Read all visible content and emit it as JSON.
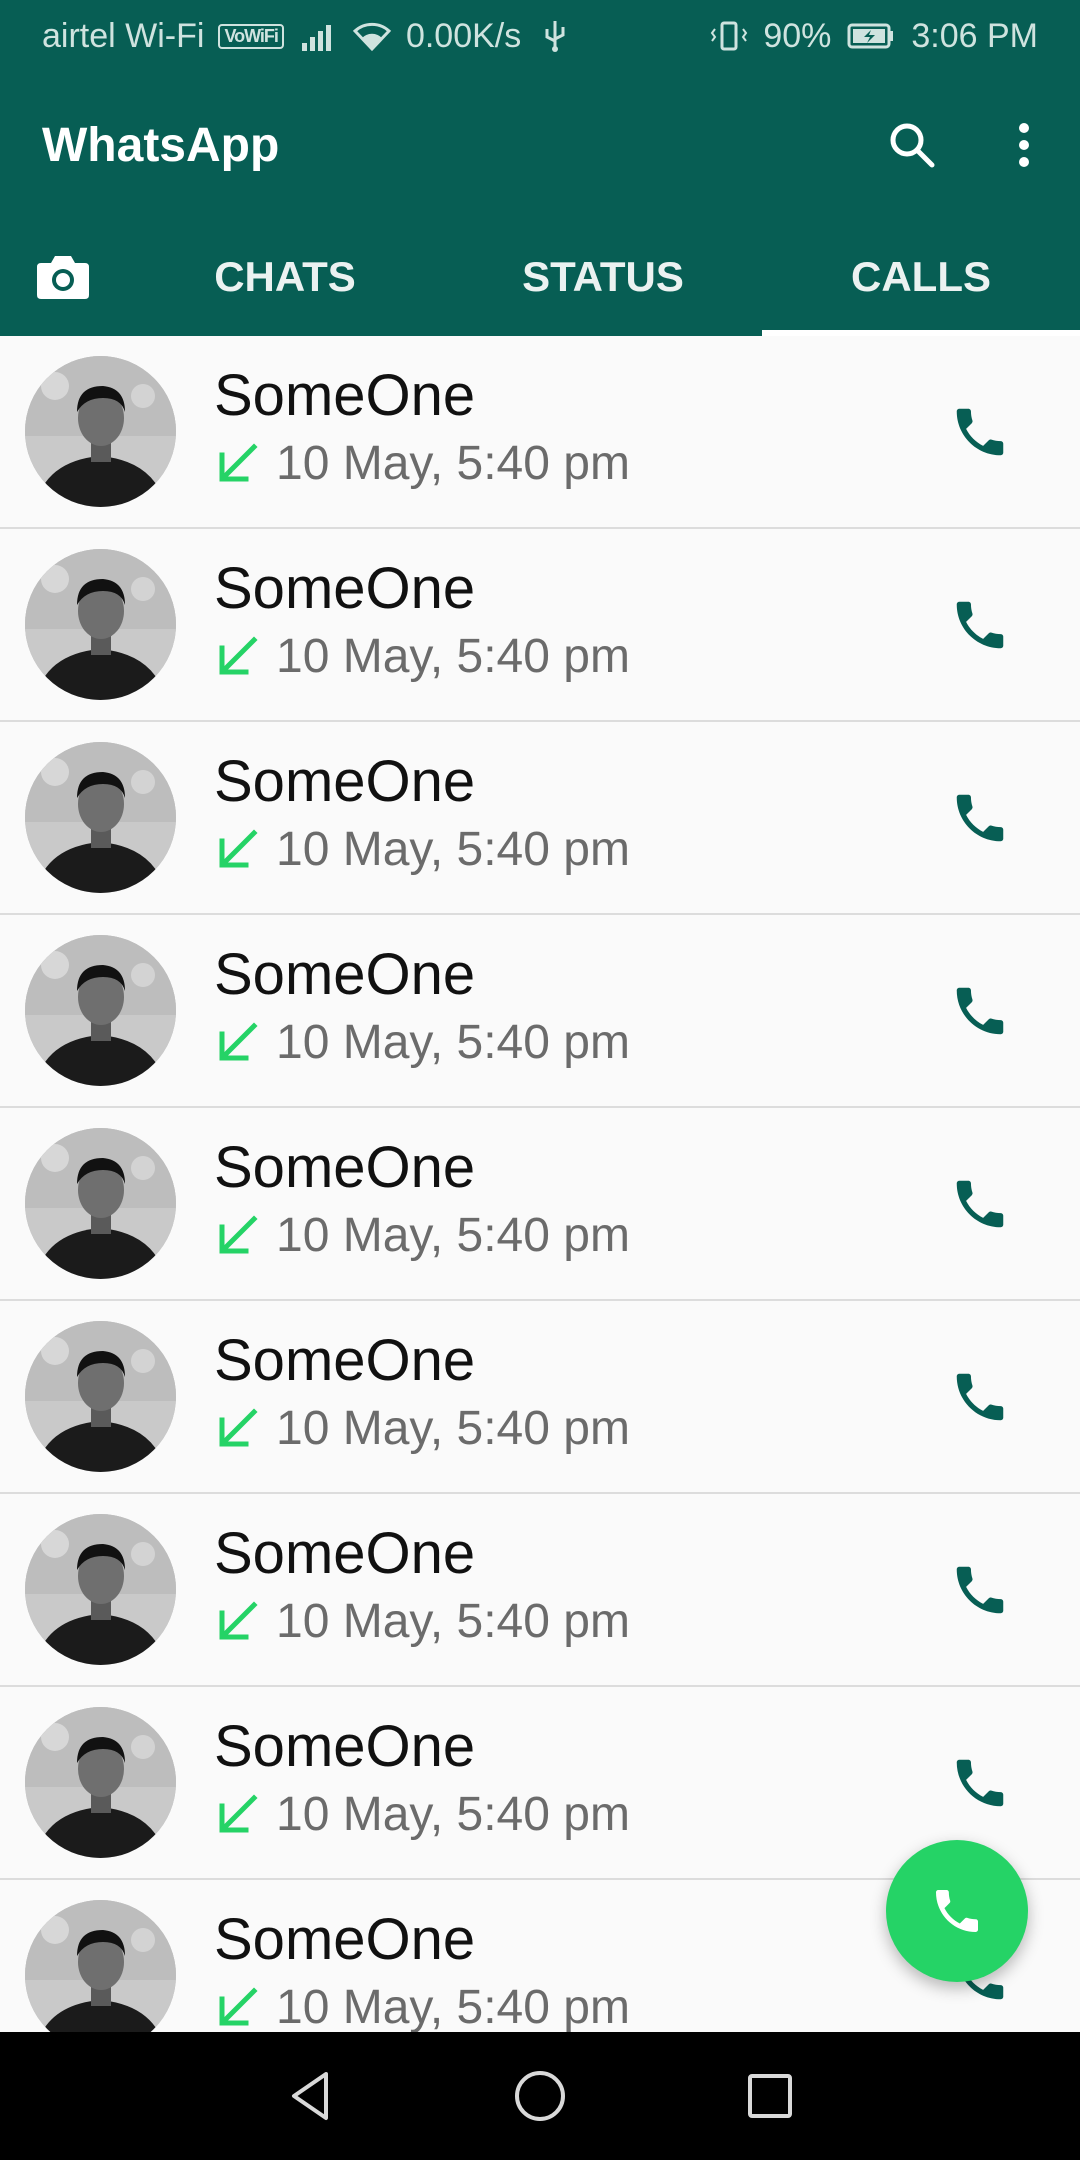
{
  "status_bar": {
    "carrier": "airtel Wi-Fi",
    "volte_badge": "VoWiFi",
    "net_speed": "0.00K/s",
    "battery": "90%",
    "time": "3:06 PM"
  },
  "header": {
    "title": "WhatsApp",
    "search_icon": "search-icon",
    "menu_icon": "more-vert-icon"
  },
  "tabs": [
    {
      "label": "",
      "icon": "camera-icon",
      "active": false
    },
    {
      "label": "CHATS",
      "active": false
    },
    {
      "label": "STATUS",
      "active": false
    },
    {
      "label": "CALLS",
      "active": true
    }
  ],
  "calls": [
    {
      "name": "SomeOne",
      "time": "10 May, 5:40 pm",
      "direction": "incoming"
    },
    {
      "name": "SomeOne",
      "time": "10 May, 5:40 pm",
      "direction": "incoming"
    },
    {
      "name": "SomeOne",
      "time": "10 May, 5:40 pm",
      "direction": "incoming"
    },
    {
      "name": "SomeOne",
      "time": "10 May, 5:40 pm",
      "direction": "incoming"
    },
    {
      "name": "SomeOne",
      "time": "10 May, 5:40 pm",
      "direction": "incoming"
    },
    {
      "name": "SomeOne",
      "time": "10 May, 5:40 pm",
      "direction": "incoming"
    },
    {
      "name": "SomeOne",
      "time": "10 May, 5:40 pm",
      "direction": "incoming"
    },
    {
      "name": "SomeOne",
      "time": "10 May, 5:40 pm",
      "direction": "incoming"
    },
    {
      "name": "SomeOne",
      "time": "10 May, 5:40 pm",
      "direction": "incoming"
    }
  ],
  "fab": {
    "icon": "new-call-icon"
  },
  "colors": {
    "primary": "#075e54",
    "accent": "#25d366",
    "call_icon": "#075e54",
    "incoming_arrow": "#25d366"
  }
}
